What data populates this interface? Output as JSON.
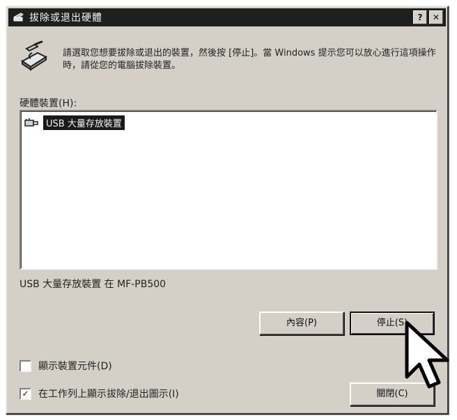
{
  "window": {
    "title": "拔除或退出硬體",
    "help_button": "?",
    "close_button": "✕"
  },
  "instruction": {
    "text": "請選取您想要拔除或退出的裝置，然後按 [停止]。當 Windows 提示您可以放心進行這項操作時，請從您的電腦拔除裝置。"
  },
  "devices": {
    "label": "硬體裝置(H):",
    "items": [
      {
        "label": "USB 大量存放裝置",
        "icon": "usb-device-icon",
        "selected": true
      }
    ]
  },
  "device_location": "USB 大量存放裝置 在 MF-PB500",
  "buttons": {
    "properties": "內容(P)",
    "stop": "停止(S)",
    "close": "關閉(C)"
  },
  "options": {
    "show_components": {
      "label": "顯示裝置元件(D)",
      "checked": false,
      "mark": ""
    },
    "show_taskbar_icon": {
      "label": "在工作列上顯示拔除/退出圖示(I)",
      "checked": true,
      "mark": "✓"
    }
  },
  "colors": {
    "titlebar": "#1f1f1f",
    "dialog_bg": "#d4d0c8",
    "selection": "#1a1a1a"
  }
}
